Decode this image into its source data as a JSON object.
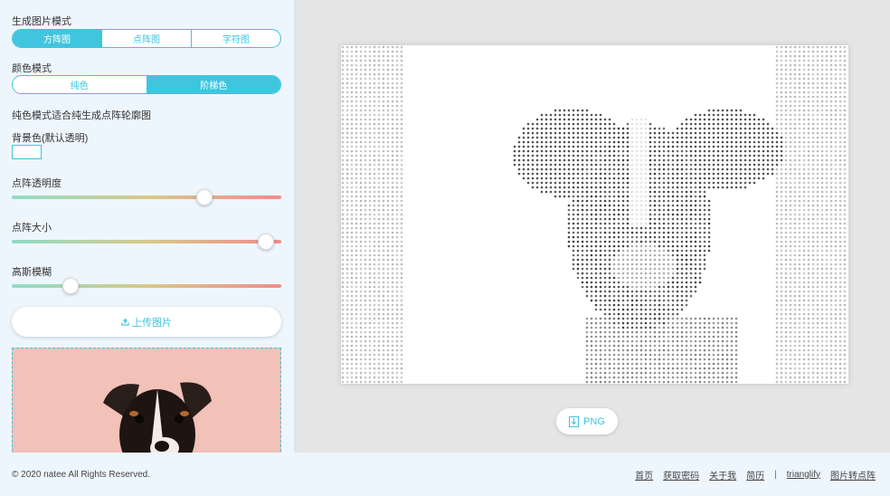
{
  "sidebar": {
    "mode_label": "生成图片模式",
    "modes": [
      {
        "label": "方阵图",
        "active": true
      },
      {
        "label": "点阵图",
        "active": false
      },
      {
        "label": "字符图",
        "active": false
      }
    ],
    "color_mode_label": "颜色模式",
    "color_modes": [
      {
        "label": "纯色",
        "active": false
      },
      {
        "label": "阶梯色",
        "active": true
      }
    ],
    "hint": "纯色模式适合纯生成点阵轮廓图",
    "bg_color_label": "背景色(默认透明)",
    "sliders": [
      {
        "label": "点阵透明度",
        "value": 0.73
      },
      {
        "label": "点阵大小",
        "value": 0.97
      },
      {
        "label": "高斯模糊",
        "value": 0.2
      }
    ],
    "upload_label": "上传图片"
  },
  "main": {
    "png_label": "PNG"
  },
  "footer": {
    "copyright": "© 2020 natee All Rights Reserved.",
    "links": [
      "首页",
      "获取密码",
      "关于我",
      "简历"
    ],
    "separator": "|",
    "links2": [
      "trianglify",
      "图片转点阵"
    ]
  },
  "colors": {
    "accent": "#40c5de",
    "sidebar_bg": "#eef6fd",
    "preview_bg": "#f2c1b8"
  },
  "icons": [
    "upload-icon",
    "download-icon"
  ]
}
